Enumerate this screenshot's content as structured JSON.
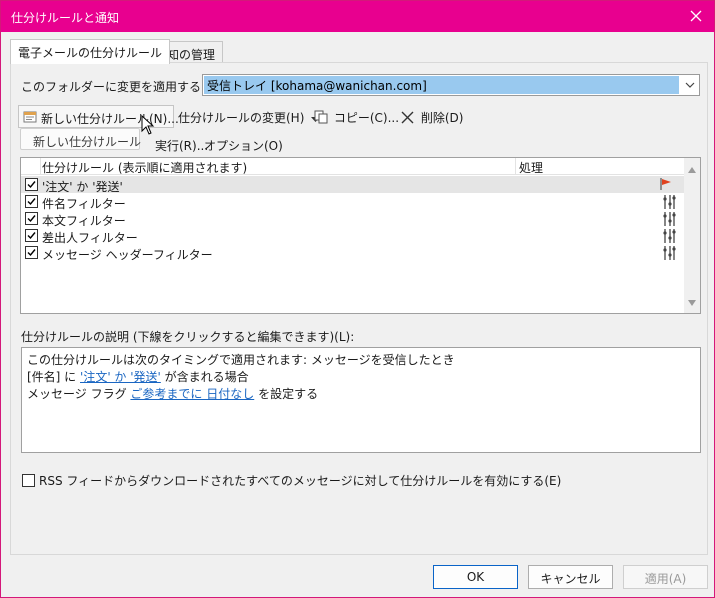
{
  "window": {
    "title": "仕分けルールと通知",
    "accent": "#e8008f"
  },
  "tabs": [
    {
      "label": "電子メールの仕分けルール",
      "active": true
    },
    {
      "label": "通知の管理",
      "active": false
    }
  ],
  "folder": {
    "label": "このフォルダーに変更を適用する(F):",
    "value": "受信トレイ [kohama@wanichan.com]"
  },
  "toolbar": {
    "new_rule": "新しい仕分けルール(N)...",
    "change_rule": "仕分けルールの変更(H)",
    "copy": "コピー(C)...",
    "delete": "削除(D)",
    "run": "実行(R)...",
    "options": "オプション(O)"
  },
  "tooltip": "新しい仕分けルール",
  "rule_list": {
    "columns": [
      "仕分けルール (表示順に適用されます)",
      "処理"
    ],
    "rows": [
      {
        "name": "'注文' か '発送'",
        "checked": true,
        "action_icon": "flag-icon",
        "selected": true
      },
      {
        "name": "件名フィルター",
        "checked": true,
        "action_icon": "move-rule-icon",
        "selected": false
      },
      {
        "name": "本文フィルター",
        "checked": true,
        "action_icon": "move-rule-icon",
        "selected": false
      },
      {
        "name": "差出人フィルター",
        "checked": true,
        "action_icon": "move-rule-icon",
        "selected": false
      },
      {
        "name": "メッセージ ヘッダーフィルター",
        "checked": true,
        "action_icon": "move-rule-icon",
        "selected": false
      }
    ]
  },
  "description": {
    "label": "仕分けルールの説明 (下線をクリックすると編集できます)(L):",
    "line1": "この仕分けルールは次のタイミングで適用されます: メッセージを受信したとき",
    "line2_prefix": "[件名] に",
    "line2_link": "'注文' か '発送'",
    "line2_suffix": "が含まれる場合",
    "line3_prefix": "メッセージ フラグ",
    "line3_link": "ご参考までに 日付なし",
    "line3_suffix": "を設定する"
  },
  "rss": {
    "label": "RSS フィードからダウンロードされたすべてのメッセージに対して仕分けルールを有効にする(E)",
    "checked": false
  },
  "footer": {
    "ok": "OK",
    "cancel": "キャンセル",
    "apply": "適用(A)"
  }
}
